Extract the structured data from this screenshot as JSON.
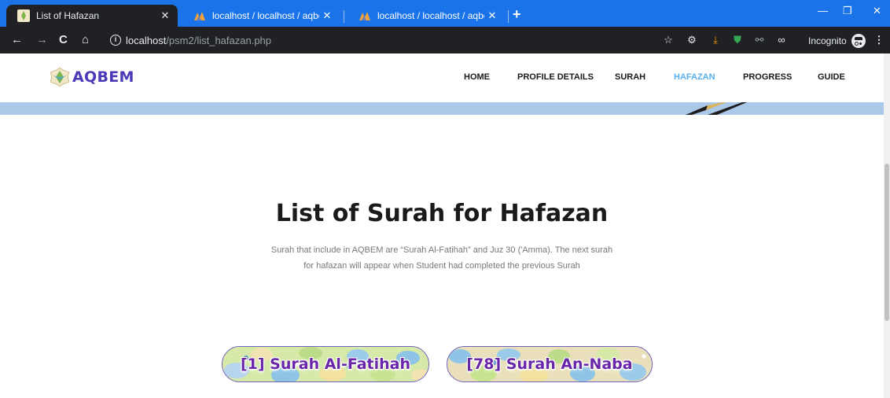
{
  "browser": {
    "tabs": [
      {
        "title": "List of Hafazan",
        "active": true
      },
      {
        "title": "localhost / localhost / aqbem / st",
        "active": false
      },
      {
        "title": "localhost / localhost / aqbem / su",
        "active": false
      }
    ],
    "url_host": "localhost",
    "url_path": "/psm2/list_hafazan.php",
    "incognito_label": "Incognito"
  },
  "site": {
    "logo_text": "AQBEM",
    "nav": [
      {
        "label": "HOME",
        "active": false
      },
      {
        "label": "PROFILE DETAILS",
        "active": false
      },
      {
        "label": "SURAH",
        "active": false
      },
      {
        "label": "HAFAZAN",
        "active": true
      },
      {
        "label": "PROGRESS",
        "active": false
      },
      {
        "label": "GUIDE",
        "active": false
      }
    ],
    "accent_color": "#5ab0ea",
    "logo_color": "#4a3ab7"
  },
  "main": {
    "title": "List of Surah for Hafazan",
    "description": "Surah that include in AQBEM are “Surah Al-Fatihah” and Juz 30 ('Amma). The next surah for hafazan will appear when Student had completed the previous Surah",
    "surah_buttons": [
      {
        "label": "[1] Surah Al-Fatihah"
      },
      {
        "label": "[78] Surah An-Naba"
      }
    ]
  }
}
